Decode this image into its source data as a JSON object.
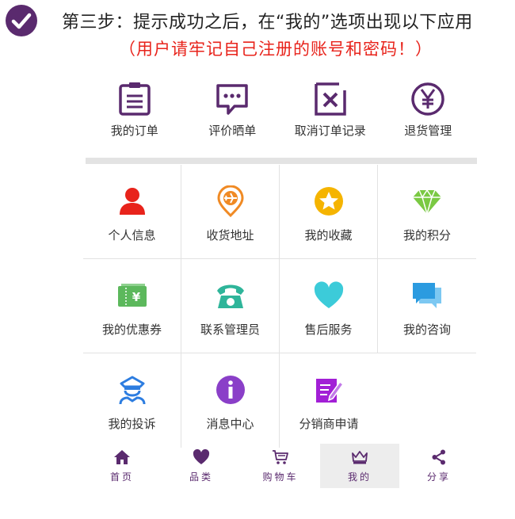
{
  "colors": {
    "brand": "#5a2a6e",
    "note_red": "#e8231b",
    "divider": "#e3e3e3"
  },
  "header": {
    "step_text": "第三步：提示成功之后，在“我的”选项出现以下应用",
    "note_text": "（用户请牢记自己注册的账号和密码！）"
  },
  "top_menu": [
    {
      "label": "我的订单",
      "icon": "clipboard-list-icon"
    },
    {
      "label": "评价晒单",
      "icon": "chat-bubble-icon"
    },
    {
      "label": "取消订单记录",
      "icon": "cancel-box-icon"
    },
    {
      "label": "退货管理",
      "icon": "yen-circle-icon"
    }
  ],
  "grid": [
    {
      "label": "个人信息",
      "icon": "user-icon",
      "color": "#e8231b"
    },
    {
      "label": "收货地址",
      "icon": "location-pin-plane-icon",
      "color": "#f08a24"
    },
    {
      "label": "我的收藏",
      "icon": "star-circle-icon",
      "color": "#f5b400"
    },
    {
      "label": "我的积分",
      "icon": "diamond-icon",
      "color": "#7ac943"
    },
    {
      "label": "我的优惠券",
      "icon": "coupon-icon",
      "color": "#5cb85c"
    },
    {
      "label": "联系管理员",
      "icon": "telephone-icon",
      "color": "#2fb59a"
    },
    {
      "label": "售后服务",
      "icon": "heart-icon",
      "color": "#3ccbd9"
    },
    {
      "label": "我的咨询",
      "icon": "chat-bubbles-icon",
      "color": "#2b9be0"
    },
    {
      "label": "我的投诉",
      "icon": "police-officer-icon",
      "color": "#2d7de0"
    },
    {
      "label": "消息中心",
      "icon": "info-circle-icon",
      "color": "#8a3fc8"
    },
    {
      "label": "分销商申请",
      "icon": "edit-form-icon",
      "color": "#a21fd6"
    }
  ],
  "tabbar": [
    {
      "label": "首页",
      "icon": "home-icon",
      "active": false
    },
    {
      "label": "品类",
      "icon": "heart-icon",
      "active": false
    },
    {
      "label": "购物车",
      "icon": "cart-icon",
      "active": false
    },
    {
      "label": "我的",
      "icon": "crown-icon",
      "active": true
    },
    {
      "label": "分享",
      "icon": "share-icon",
      "active": false
    }
  ]
}
